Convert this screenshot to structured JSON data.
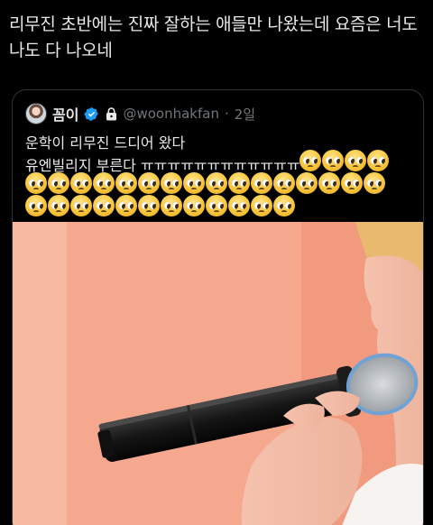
{
  "tweet": {
    "text": "리무진 초반에는 진짜 잘하는 애들만 나왔는데 요즘은 너도\n나도 다 나오네"
  },
  "quoted_tweet": {
    "display_name": "꼼이",
    "handle": "@woonhakfan",
    "separator": "·",
    "time": "2일",
    "text_line1": "운학이 리무진 드디어 왔다",
    "text_line2": "유엔빌리지 부른다 ㅠㅠㅠㅠㅠㅠㅠㅠㅠㅠㅠㅠ",
    "emoji_name": "pleading-face-emoji",
    "emoji_count_line1": 4,
    "emoji_count_line2": 16,
    "emoji_count_line3": 12,
    "verified_color": "#1d9bf0",
    "media_description_icon": "microphone-photo"
  }
}
